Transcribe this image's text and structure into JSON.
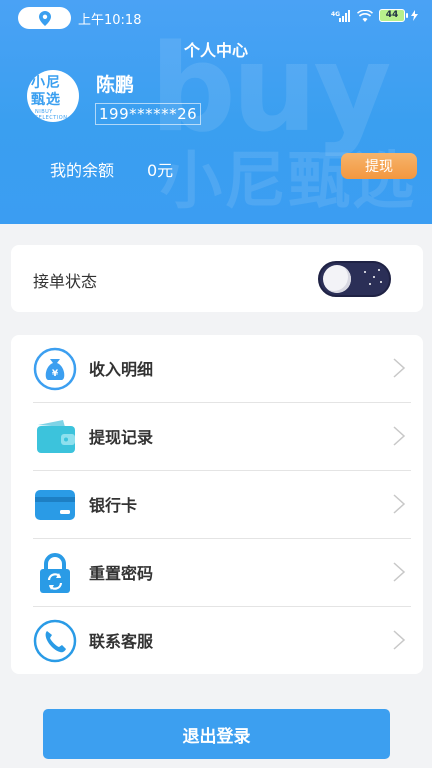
{
  "status_bar": {
    "time": "上午10:18",
    "network": "4G",
    "battery": "44",
    "location_icon": "location-pin-icon",
    "signal_icon": "signal-bars-icon",
    "wifi_icon": "wifi-icon",
    "charging_icon": "charging-bolt-icon"
  },
  "header": {
    "title": "个人中心",
    "watermark_en": "buy",
    "watermark_cn": "小尼甄选"
  },
  "profile": {
    "avatar_line1": "小尼",
    "avatar_line2": "甄选",
    "avatar_line3": "NIBUY SELECTION",
    "name": "陈鹏",
    "phone": "199******26"
  },
  "balance": {
    "label": "我的余额",
    "value": "0元",
    "withdraw_label": "提现"
  },
  "order_status": {
    "label": "接单状态",
    "enabled": false
  },
  "menu": {
    "items": [
      {
        "label": "收入明细",
        "icon": "money-bag-icon"
      },
      {
        "label": "提现记录",
        "icon": "wallet-icon"
      },
      {
        "label": "银行卡",
        "icon": "bank-card-icon"
      },
      {
        "label": "重置密码",
        "icon": "padlock-reset-icon"
      },
      {
        "label": "联系客服",
        "icon": "phone-icon"
      }
    ]
  },
  "logout": {
    "label": "退出登录"
  },
  "colors": {
    "primary": "#3c9ff0",
    "withdraw": "#f39740",
    "toggle_dark": "#2b2f57",
    "background": "#f2f3f5"
  }
}
